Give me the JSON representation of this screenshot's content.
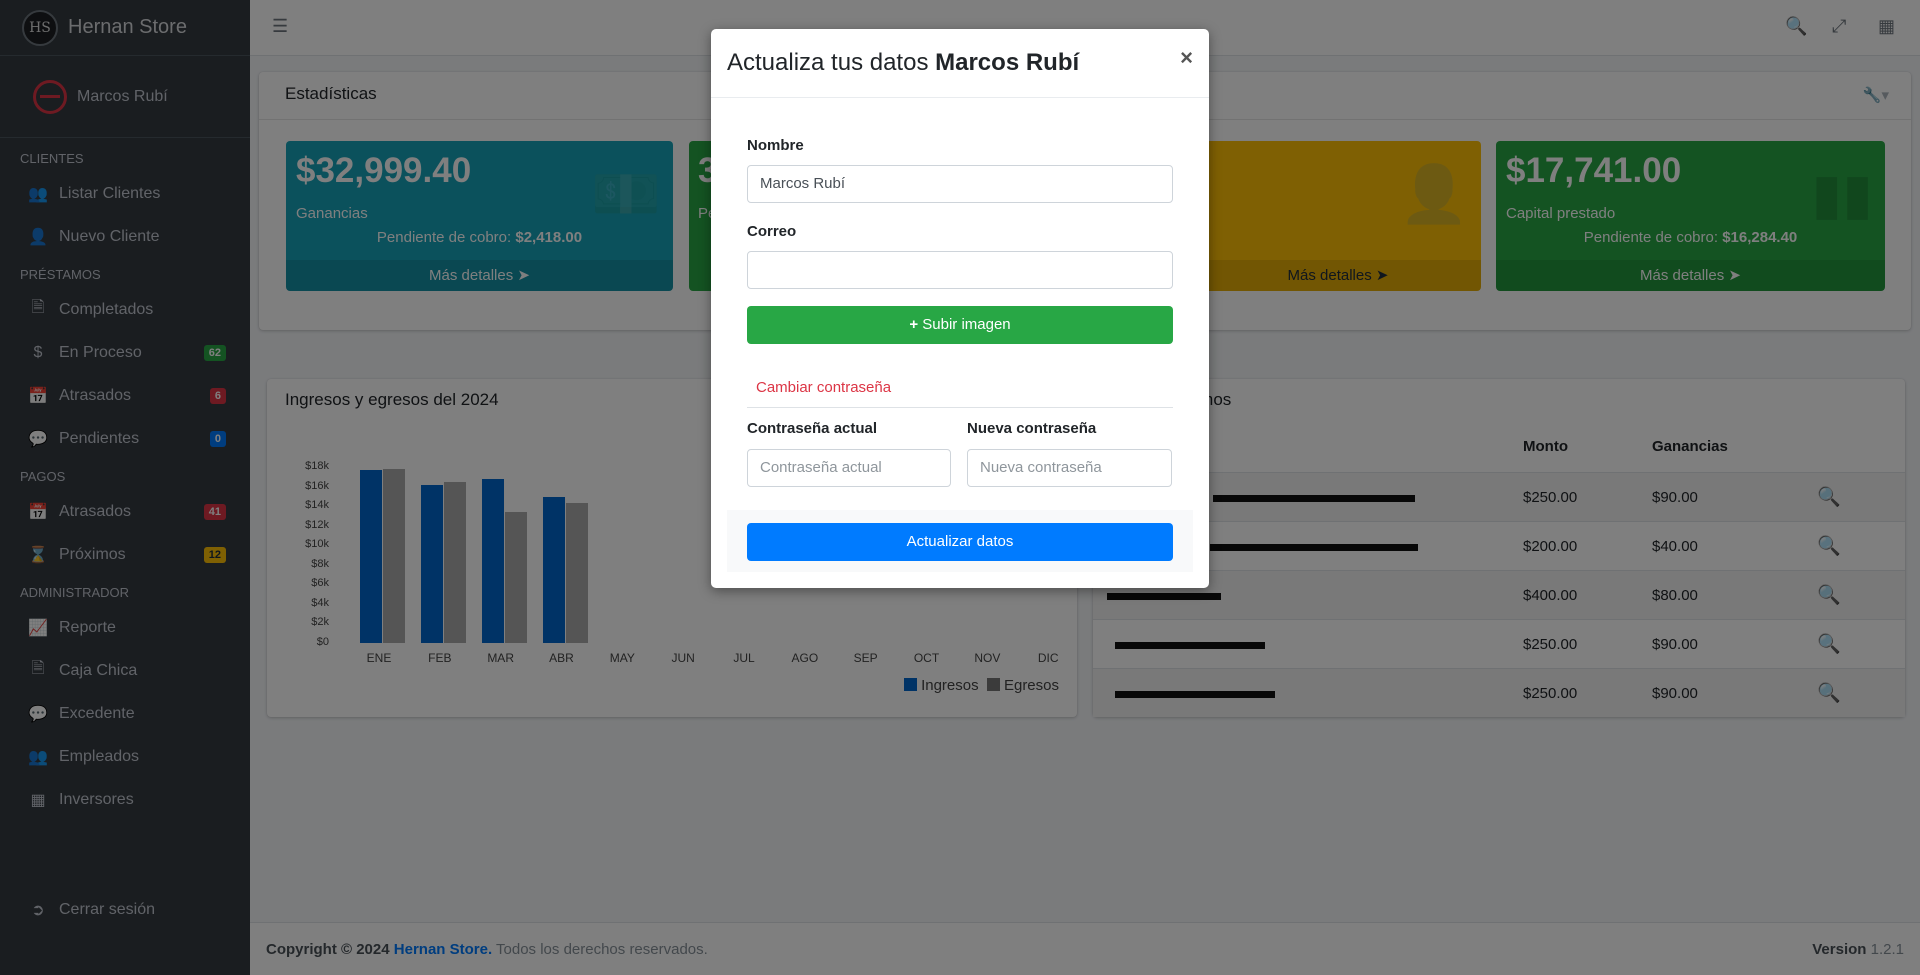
{
  "brand": {
    "name": "Hernan Store",
    "logo_text": "HS"
  },
  "user": {
    "name": "Marcos Rubí"
  },
  "sidebar": {
    "sections": [
      {
        "header": "CLIENTES"
      },
      {
        "header": "PRÉSTAMOS"
      },
      {
        "header": "PAGOS"
      },
      {
        "header": "ADMINISTRADOR"
      }
    ],
    "items": [
      {
        "label": "Listar Clientes",
        "icon": "users-icon"
      },
      {
        "label": "Nuevo Cliente",
        "icon": "user-plus-icon"
      },
      {
        "label": "Completados",
        "icon": "file-icon"
      },
      {
        "label": "En Proceso",
        "icon": "dollar-icon",
        "badge": "62",
        "badge_color": "#28a745"
      },
      {
        "label": "Atrasados",
        "icon": "calendar-x-icon",
        "badge": "6",
        "badge_color": "#dc3545"
      },
      {
        "label": "Pendientes",
        "icon": "comments-icon",
        "badge": "0",
        "badge_color": "#007bff"
      },
      {
        "label": "Atrasados",
        "icon": "calendar-x-icon",
        "badge": "41",
        "badge_color": "#dc3545"
      },
      {
        "label": "Próximos",
        "icon": "hourglass-icon",
        "badge": "12",
        "badge_color": "#ffc107"
      },
      {
        "label": "Reporte",
        "icon": "chart-icon"
      },
      {
        "label": "Caja Chica",
        "icon": "file-invoice-icon"
      },
      {
        "label": "Excedente",
        "icon": "comments-icon"
      },
      {
        "label": "Empleados",
        "icon": "users-icon"
      },
      {
        "label": "Inversores",
        "icon": "table-icon"
      },
      {
        "label": "Cerrar sesión",
        "icon": "sign-out-icon"
      }
    ]
  },
  "stats": {
    "title": "Estadísticas",
    "boxes": [
      {
        "value": "$32,999.40",
        "label": "Ganancias",
        "pending_label": "Pendiente de cobro:",
        "pending_value": "$2,418.00",
        "footer": "Más detalles",
        "color": "#17a2b8"
      },
      {
        "value": "3",
        "label": "Pe",
        "footer": "",
        "color": "#28a745"
      },
      {
        "value": "",
        "label": "",
        "footer": "Más detalles",
        "color": "#ffc107"
      },
      {
        "value": "$17,741.00",
        "label": "Capital prestado",
        "pending_label": "Pendiente de cobro:",
        "pending_value": "$16,284.40",
        "footer": "Más detalles",
        "color": "#28a745"
      }
    ]
  },
  "chart": {
    "title": "Ingresos y egresos del 2024",
    "legend": [
      "Ingresos",
      "Egresos"
    ]
  },
  "chart_data": {
    "type": "bar",
    "title": "Ingresos y egresos del 2024",
    "categories": [
      "ENE",
      "FEB",
      "MAR",
      "ABR",
      "MAY",
      "JUN",
      "JUL",
      "AGO",
      "SEP",
      "OCT",
      "NOV",
      "DIC"
    ],
    "series": [
      {
        "name": "Ingresos",
        "color": "#0066cc",
        "values": [
          17700,
          16200,
          16800,
          14900,
          0,
          0,
          0,
          0,
          0,
          0,
          0,
          0
        ]
      },
      {
        "name": "Egresos",
        "color": "#aaaaaa",
        "values": [
          17800,
          16500,
          13400,
          14300,
          0,
          0,
          0,
          0,
          0,
          0,
          0,
          0
        ]
      }
    ],
    "yticks": [
      "$0",
      "$2k",
      "$4k",
      "$6k",
      "$8k",
      "$10k",
      "$12k",
      "$14k",
      "$16k",
      "$18k"
    ],
    "ylim": [
      0,
      18000
    ],
    "legend_position": "bottom-right"
  },
  "loans": {
    "title_fragment": "tamos",
    "headers": {
      "monto": "Monto",
      "ganancias": "Ganancias"
    },
    "rows": [
      {
        "monto": "$250.00",
        "ganancias": "$90.00"
      },
      {
        "monto": "$200.00",
        "ganancias": "$40.00"
      },
      {
        "monto": "$400.00",
        "ganancias": "$80.00"
      },
      {
        "monto": "$250.00",
        "ganancias": "$90.00"
      },
      {
        "monto": "$250.00",
        "ganancias": "$90.00"
      }
    ]
  },
  "footer": {
    "copyright": "Copyright © 2024",
    "brand": "Hernan Store.",
    "rights": "Todos los derechos reservados.",
    "version_label": "Version",
    "version": "1.2.1"
  },
  "modal": {
    "title_prefix": "Actualiza tus datos",
    "title_name": "Marcos Rubí",
    "close": "×",
    "nombre_label": "Nombre",
    "nombre_value": "Marcos Rubí",
    "correo_label": "Correo",
    "correo_value": "",
    "upload_label": "Subir imagen",
    "change_pw_tab": "Cambiar contraseña",
    "current_pw_label": "Contraseña actual",
    "current_pw_placeholder": "Contraseña actual",
    "new_pw_label": "Nueva contraseña",
    "new_pw_placeholder": "Nueva contraseña",
    "submit_label": "Actualizar datos"
  }
}
